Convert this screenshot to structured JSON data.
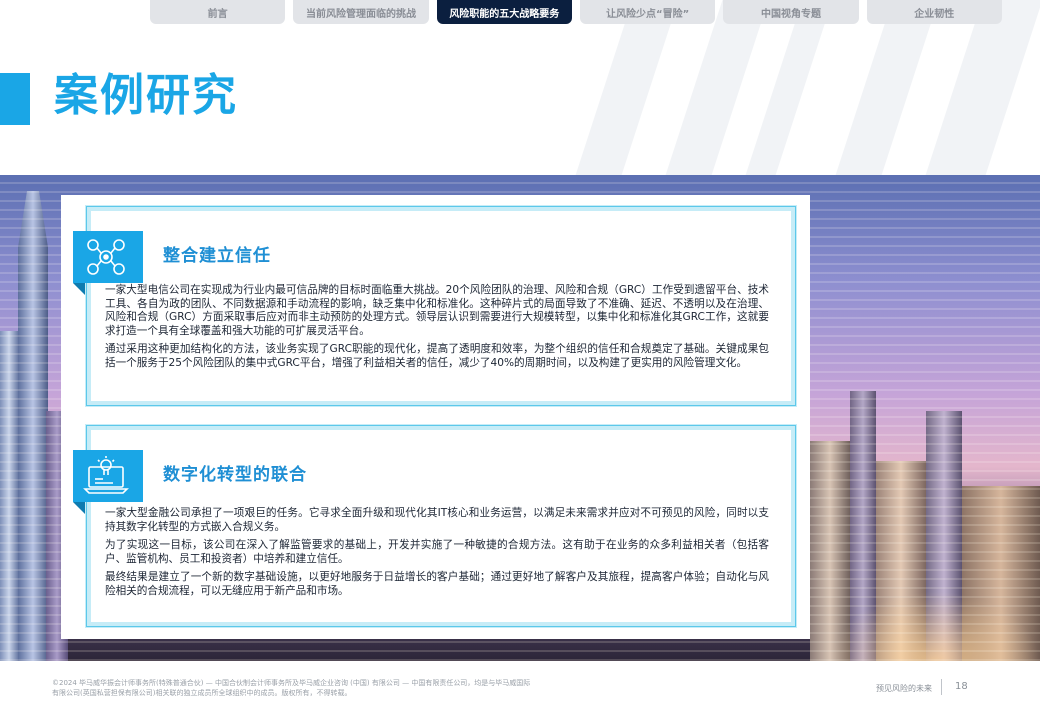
{
  "nav": {
    "tabs": [
      {
        "label": "前言",
        "active": false
      },
      {
        "label": "当前风险管理面临的挑战",
        "active": false
      },
      {
        "label": "风险职能的五大战略要务",
        "active": true
      },
      {
        "label": "让风险少点“冒险”",
        "active": false
      },
      {
        "label": "中国视角专题",
        "active": false
      },
      {
        "label": "企业韧性",
        "active": false
      }
    ]
  },
  "page": {
    "title": "案例研究"
  },
  "cases": [
    {
      "icon": "drone-network-icon",
      "title": "整合建立信任",
      "paragraphs": [
        "一家大型电信公司在实现成为行业内最可信品牌的目标时面临重大挑战。20个风险团队的治理、风险和合规（GRC）工作受到遗留平台、技术工具、各自为政的团队、不同数据源和手动流程的影响，缺乏集中化和标准化。这种碎片式的局面导致了不准确、延迟、不透明以及在治理、风险和合规（GRC）方面采取事后应对而非主动预防的处理方式。领导层认识到需要进行大规模转型，以集中化和标准化其GRC工作，这就要求打造一个具有全球覆盖和强大功能的可扩展灵活平台。",
        "通过采用这种更加结构化的方法，该业务实现了GRC职能的现代化，提高了透明度和效率，为整个组织的信任和合规奠定了基础。关键成果包括一个服务于25个风险团队的集中式GRC平台，增强了利益相关者的信任，减少了40%的周期时间，以及构建了更实用的风险管理文化。"
      ]
    },
    {
      "icon": "laptop-idea-icon",
      "title": "数字化转型的联合",
      "paragraphs": [
        "一家大型金融公司承担了一项艰巨的任务。它寻求全面升级和现代化其IT核心和业务运营，以满足未来需求并应对不可预见的风险，同时以支持其数字化转型的方式嵌入合规义务。",
        "为了实现这一目标，该公司在深入了解监管要求的基础上，开发并实施了一种敏捷的合规方法。这有助于在业务的众多利益相关者（包括客户、监管机构、员工和投资者）中培养和建立信任。",
        "最终结果是建立了一个新的数字基础设施，以更好地服务于日益增长的客户基础；通过更好地了解客户及其旅程，提高客户体验；自动化与风险相关的合规流程，可以无缝应用于新产品和市场。"
      ]
    }
  ],
  "footer": {
    "legal_line1": "©2024 毕马威华振会计师事务所(特殊普通合伙) — 中国合伙制会计师事务所及毕马威企业咨询 (中国) 有限公司 — 中国有限责任公司，均是与毕马威国际",
    "legal_line2": "有限公司(英国私营担保有限公司)相关联的独立成员所全球组织中的成员。版权所有，不得转载。",
    "tagline": "预见风险的未来",
    "page_number": "18"
  },
  "colors": {
    "accent": "#1aa6e6",
    "nav_active": "#0b1f3f",
    "card_border": "#c6ecf7"
  }
}
